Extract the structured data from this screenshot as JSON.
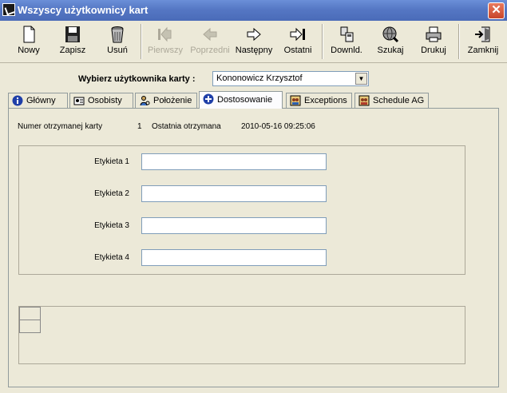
{
  "window": {
    "title": "Wszyscy użytkownicy kart",
    "close_label": "✕"
  },
  "toolbar": {
    "buttons": [
      {
        "label": "Nowy",
        "icon": "new-document-icon",
        "enabled": true
      },
      {
        "label": "Zapisz",
        "icon": "floppy-disk-icon",
        "enabled": true
      },
      {
        "label": "Usuń",
        "icon": "trash-bin-icon",
        "enabled": true
      },
      {
        "label": "Pierwszy",
        "icon": "first-record-icon",
        "enabled": false
      },
      {
        "label": "Poprzedni",
        "icon": "previous-arrow-icon",
        "enabled": false
      },
      {
        "label": "Następny",
        "icon": "next-arrow-icon",
        "enabled": true
      },
      {
        "label": "Ostatni",
        "icon": "last-record-icon",
        "enabled": true
      },
      {
        "label": "Downld.",
        "icon": "download-device-icon",
        "enabled": true
      },
      {
        "label": "Szukaj",
        "icon": "search-globe-icon",
        "enabled": true
      },
      {
        "label": "Drukuj",
        "icon": "printer-icon",
        "enabled": true
      },
      {
        "label": "Zamknij",
        "icon": "exit-door-icon",
        "enabled": true
      }
    ]
  },
  "user_selector": {
    "label": "Wybierz użytkownika karty :",
    "value": "Kononowicz Krzysztof"
  },
  "tabs": [
    {
      "label": "Główny",
      "icon": "info-icon"
    },
    {
      "label": "Osobisty",
      "icon": "person-card-icon"
    },
    {
      "label": "Położenie",
      "icon": "location-person-icon"
    },
    {
      "label": "Dostosowanie",
      "icon": "plus-circle-icon",
      "active": true
    },
    {
      "label": "Exceptions",
      "icon": "people-calendar-icon"
    },
    {
      "label": "Schedule AG",
      "icon": "people-schedule-icon"
    }
  ],
  "card_info": {
    "card_number_label": "Numer otrzymanej karty",
    "card_number_value": "1",
    "last_received_label": "Ostatnia otrzymana",
    "last_received_value": "2010-05-16 09:25:06"
  },
  "labels": {
    "fields": [
      {
        "label": "Etykieta 1",
        "value": ""
      },
      {
        "label": "Etykieta 2",
        "value": ""
      },
      {
        "label": "Etykieta 3",
        "value": ""
      },
      {
        "label": "Etykieta 4",
        "value": ""
      }
    ]
  },
  "colors": {
    "titlebar": "#5577c4",
    "close": "#c8452a",
    "face": "#ece9d8",
    "input_border": "#7f9db9"
  }
}
